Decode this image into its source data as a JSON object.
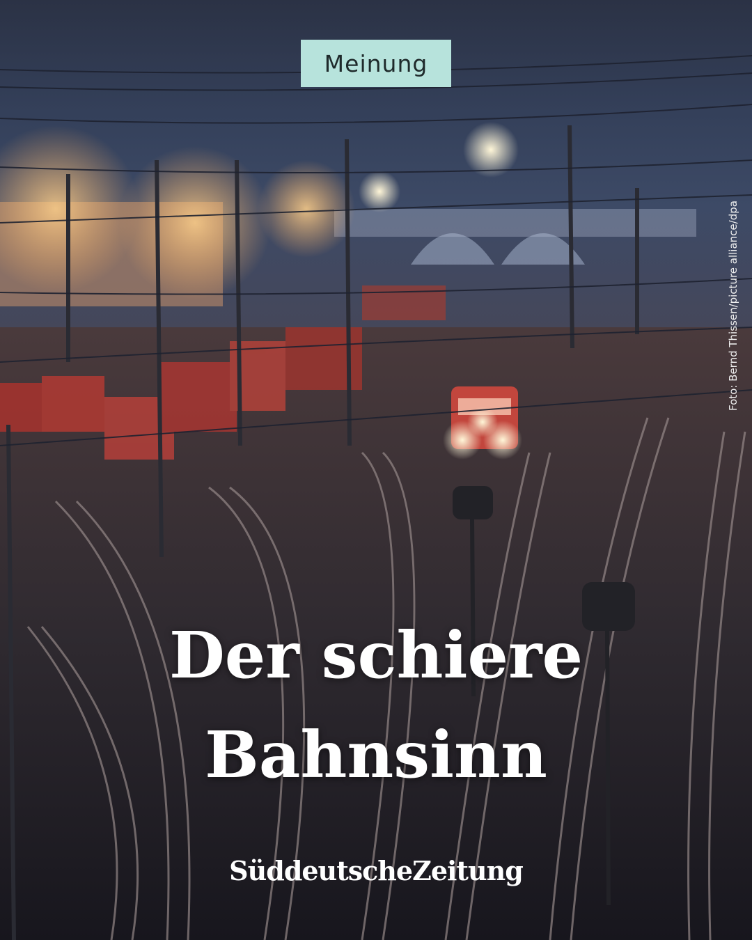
{
  "category_tag": "Meinung",
  "photo_credit": "Foto: Bernd Thissen/picture alliance/dpa",
  "headline": {
    "line1": "Der schiere",
    "line2": "Bahnsinn"
  },
  "brand": "SüddeutscheZeitung",
  "colors": {
    "tag_background": "#b7e3dc",
    "headline_text": "#ffffff"
  }
}
